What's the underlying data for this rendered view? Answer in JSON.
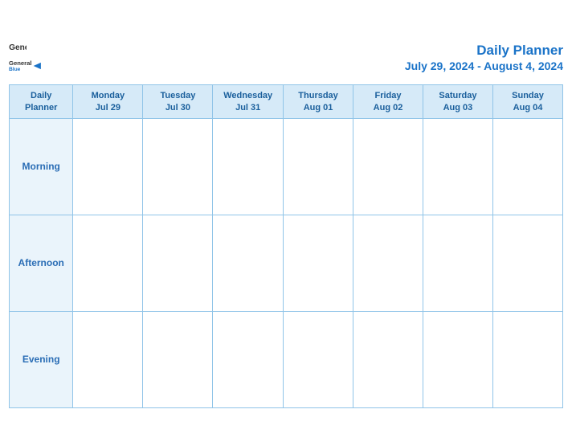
{
  "header": {
    "logo_general": "General",
    "logo_blue": "Blue",
    "title": "Daily Planner",
    "date_range": "July 29, 2024 - August 4, 2024"
  },
  "table": {
    "col_header_label": "Daily\nPlanner",
    "columns": [
      {
        "day": "Monday",
        "date": "Jul 29"
      },
      {
        "day": "Tuesday",
        "date": "Jul 30"
      },
      {
        "day": "Wednesday",
        "date": "Jul 31"
      },
      {
        "day": "Thursday",
        "date": "Aug 01"
      },
      {
        "day": "Friday",
        "date": "Aug 02"
      },
      {
        "day": "Saturday",
        "date": "Aug 03"
      },
      {
        "day": "Sunday",
        "date": "Aug 04"
      }
    ],
    "rows": [
      {
        "label": "Morning"
      },
      {
        "label": "Afternoon"
      },
      {
        "label": "Evening"
      }
    ]
  }
}
